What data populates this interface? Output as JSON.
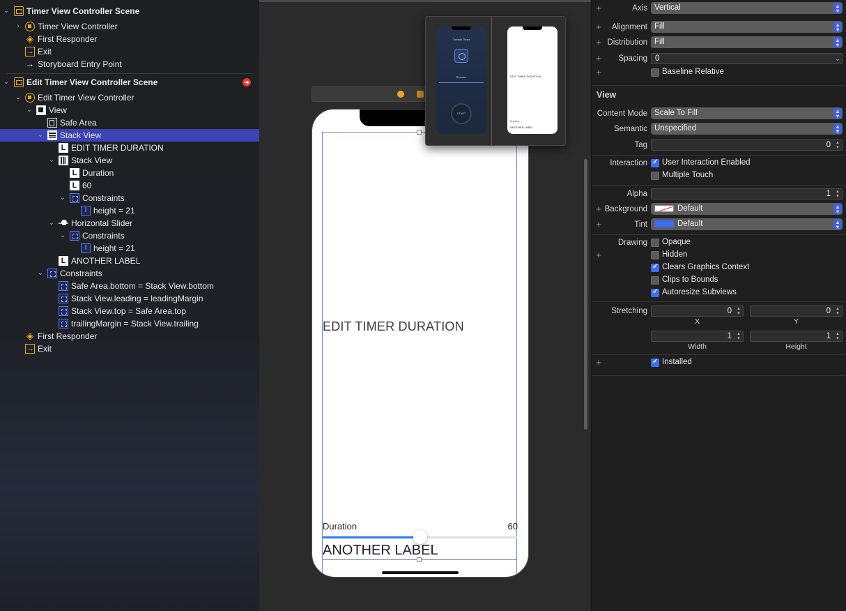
{
  "outline": {
    "scene1": {
      "title": "Timer View Controller Scene",
      "items": [
        "Timer View Controller",
        "First Responder",
        "Exit",
        "Storyboard Entry Point"
      ]
    },
    "scene2": {
      "title": "Edit Timer View Controller Scene",
      "controller": "Edit Timer View Controller",
      "view": "View",
      "safe_area": "Safe Area",
      "stack_view": "Stack View",
      "edit_label": "EDIT TIMER DURATION",
      "inner_stack": "Stack View",
      "duration": "Duration",
      "sixty": "60",
      "constraints": "Constraints",
      "height1": "height = 21",
      "slider": "Horizontal Slider",
      "height2": "height = 21",
      "another": "ANOTHER LABEL",
      "c1": "Safe Area.bottom = Stack View.bottom",
      "c2": "Stack View.leading = leadingMargin",
      "c3": "Stack View.top = Safe Area.top",
      "c4": "trailingMargin = Stack View.trailing",
      "first_responder": "First Responder",
      "exit": "Exit"
    }
  },
  "canvas": {
    "edit_title": "EDIT TIMER DURATION",
    "duration_label": "Duration",
    "duration_value": "60",
    "slider_fraction": 0.5,
    "another_label": "ANOTHER LABEL"
  },
  "inspector": {
    "axis": {
      "label": "Axis",
      "value": "Vertical"
    },
    "alignment": {
      "label": "Alignment",
      "value": "Fill"
    },
    "distribution": {
      "label": "Distribution",
      "value": "Fill"
    },
    "spacing": {
      "label": "Spacing",
      "value": "0"
    },
    "baseline": "Baseline Relative",
    "view_section": "View",
    "content_mode": {
      "label": "Content Mode",
      "value": "Scale To Fill"
    },
    "semantic": {
      "label": "Semantic",
      "value": "Unspecified"
    },
    "tag": {
      "label": "Tag",
      "value": "0"
    },
    "interaction": {
      "label": "Interaction",
      "user_interaction": "User Interaction Enabled",
      "multiple_touch": "Multiple Touch"
    },
    "alpha": {
      "label": "Alpha",
      "value": "1"
    },
    "background": {
      "label": "Background",
      "value": "Default"
    },
    "tint": {
      "label": "Tint",
      "value": "Default"
    },
    "drawing": {
      "label": "Drawing",
      "opaque": "Opaque",
      "hidden": "Hidden",
      "clears": "Clears Graphics Context",
      "clips": "Clips to Bounds",
      "autoresize": "Autoresize Subviews"
    },
    "stretching": {
      "label": "Stretching",
      "x": "0",
      "y": "0",
      "width": "1",
      "height": "1",
      "x_label": "X",
      "y_label": "Y",
      "w_label": "Width",
      "h_label": "Height"
    },
    "installed": "Installed",
    "tint_color": "#3d6df2"
  },
  "preview": {
    "mini1_title": "Tomato Timer",
    "mini1_mid": "Resume",
    "mini1_start": "START",
    "mini2_title": "EDIT TIMER DURATION",
    "mini2_duration": "Duration",
    "mini2_another": "ANOTHER LABEL"
  }
}
